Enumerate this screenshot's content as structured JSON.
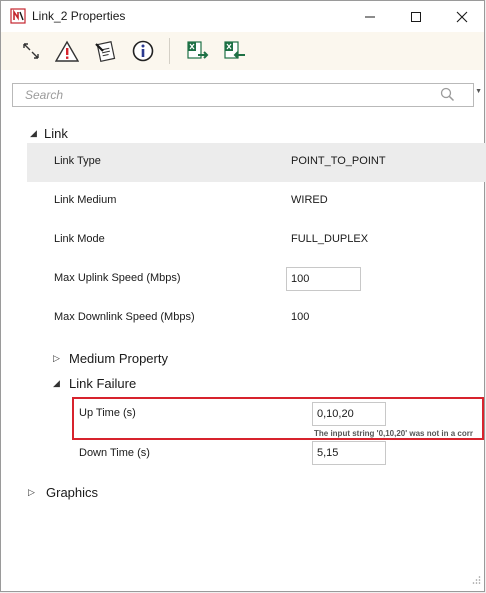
{
  "window": {
    "title": "Link_2 Properties"
  },
  "toolbar": {
    "tools": [
      "expand-collapse-icon",
      "warning-icon",
      "edit-document-icon",
      "info-icon",
      "export-excel-icon",
      "import-excel-icon"
    ]
  },
  "search": {
    "placeholder": "Search"
  },
  "groups": {
    "link": {
      "label": "Link"
    },
    "medium_property": {
      "label": "Medium Property"
    },
    "link_failure": {
      "label": "Link Failure"
    },
    "graphics": {
      "label": "Graphics"
    }
  },
  "properties": {
    "link_type": {
      "name": "Link Type",
      "value": "POINT_TO_POINT"
    },
    "link_medium": {
      "name": "Link Medium",
      "value": "WIRED"
    },
    "link_mode": {
      "name": "Link Mode",
      "value": "FULL_DUPLEX"
    },
    "max_uplink": {
      "name": "Max Uplink Speed (Mbps)",
      "value": "100"
    },
    "max_downlink": {
      "name": "Max Downlink Speed (Mbps)",
      "value": "100"
    },
    "up_time": {
      "name": "Up Time (s)",
      "value": "0,10,20",
      "error": "The input string '0,10,20' was not in a corr"
    },
    "down_time": {
      "name": "Down Time (s)",
      "value": "5,15"
    }
  },
  "colors": {
    "error_border": "#d7232d",
    "toolbar_bg": "#fbf7ee",
    "selected_row": "#ececec"
  }
}
